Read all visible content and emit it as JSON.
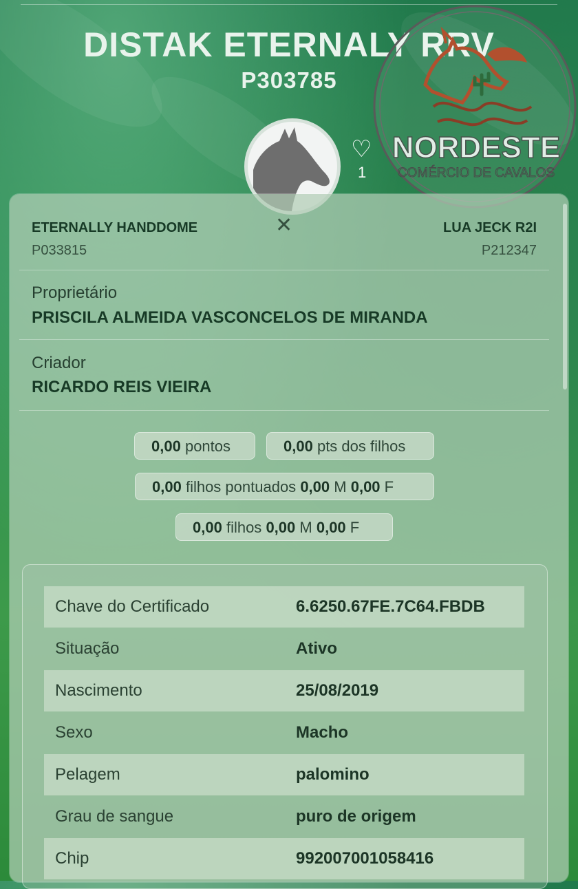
{
  "header": {
    "name": "DISTAK ETERNALY RRV",
    "registration": "P303785"
  },
  "logo": {
    "brand": "NORDESTE",
    "tagline": "COMÉRCIO DE CAVALOS"
  },
  "likes": {
    "icon": "heart-outline-icon",
    "count": "1"
  },
  "parents": {
    "sire": {
      "name": "ETERNALLY HANDDOME",
      "registration": "P033815"
    },
    "dam": {
      "name": "LUA JECK R2I",
      "registration": "P212347"
    },
    "separator": "✕"
  },
  "owner": {
    "label": "Proprietário",
    "value": "PRISCILA ALMEIDA VASCONCELOS DE MIRANDA"
  },
  "breeder": {
    "label": "Criador",
    "value": "RICARDO REIS VIEIRA"
  },
  "stats": {
    "points": {
      "value": "0,00",
      "label": "pontos"
    },
    "offspring_points": {
      "value": "0,00",
      "label": "pts dos filhos"
    },
    "scored_offspring": {
      "value": "0,00",
      "label": "filhos pontuados",
      "m": "0,00",
      "m_label": "M",
      "f": "0,00",
      "f_label": "F"
    },
    "offspring": {
      "value": "0,00",
      "label": "filhos",
      "m": "0,00",
      "m_label": "M",
      "f": "0,00",
      "f_label": "F"
    }
  },
  "details": [
    {
      "label": "Chave do Certificado",
      "value": "6.6250.67FE.7C64.FBDB"
    },
    {
      "label": "Situação",
      "value": "Ativo"
    },
    {
      "label": "Nascimento",
      "value": "25/08/2019"
    },
    {
      "label": "Sexo",
      "value": "Macho"
    },
    {
      "label": "Pelagem",
      "value": "palomino"
    },
    {
      "label": "Grau de sangue",
      "value": "puro de origem"
    },
    {
      "label": "Chip",
      "value": "992007001058416"
    }
  ],
  "colors": {
    "background": "#2f8f55",
    "card": "#b2cdb6",
    "text_dark": "#173a26",
    "logo_red": "#b2502e",
    "logo_ring": "#5a5a5a"
  }
}
